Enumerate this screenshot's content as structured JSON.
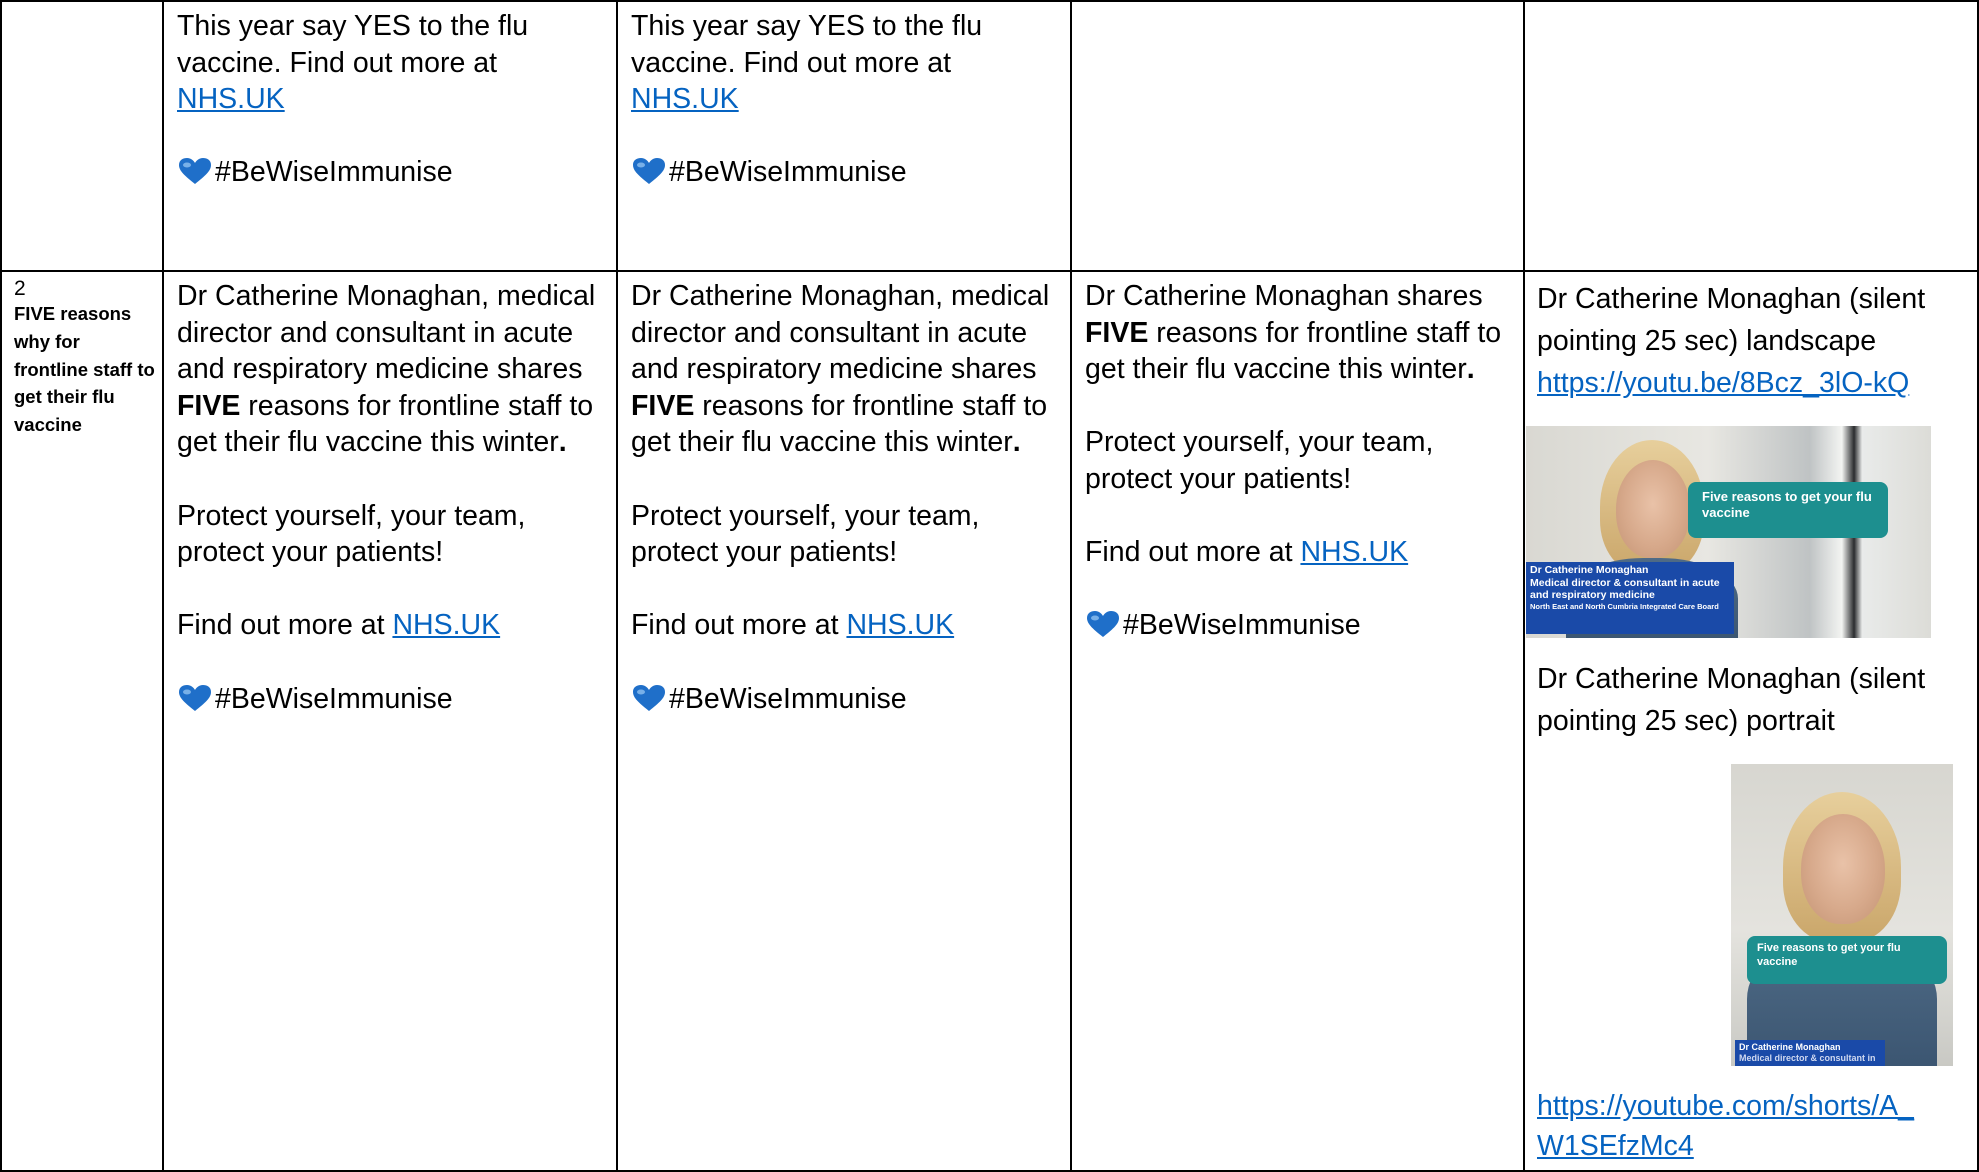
{
  "row1": {
    "col2": {
      "line1": "This year say YES to the flu vaccine. Find out more at",
      "link": "NHS.UK",
      "hashtag": "#BeWiseImmunise"
    },
    "col3": {
      "line1": "This year say YES to the flu vaccine. Find out more at",
      "link": "NHS.UK",
      "hashtag": "#BeWiseImmunise"
    }
  },
  "row2": {
    "col1": {
      "number": "2",
      "label": "FIVE reasons why for frontline staff to get their flu vaccine"
    },
    "col2": {
      "intro": "Dr Catherine Monaghan, medical director and consultant in acute and respiratory medicine shares",
      "bold": "FIVE",
      "rest": "reasons for frontline staff to get their flu vaccine this winter",
      "period": ".",
      "protect": "Protect yourself, your team, protect your patients!",
      "find_prefix": "Find out more at",
      "link": "NHS.UK",
      "hashtag": "#BeWiseImmunise"
    },
    "col3": {
      "intro": "Dr Catherine Monaghan, medical director and consultant in acute and respiratory medicine shares",
      "bold": "FIVE",
      "rest": "reasons for frontline staff to get their flu vaccine this winter",
      "period": ".",
      "protect": "Protect yourself, your team, protect your patients!",
      "find_prefix": "Find out more at",
      "link": "NHS.UK",
      "hashtag": "#BeWiseImmunise"
    },
    "col4": {
      "intro": "Dr Catherine Monaghan shares",
      "bold": "FIVE",
      "rest": "reasons for frontline staff to get their flu vaccine this winter",
      "period": ".",
      "protect": "Protect yourself, your team, protect your patients!",
      "find_prefix": "Find out more at",
      "link": "NHS.UK",
      "hashtag": "#BeWiseImmunise"
    },
    "col5": {
      "landscape_caption": "Dr Catherine Monaghan (silent pointing 25 sec) landscape",
      "landscape_link": "https://youtu.be/8Bcz_3lO-kQ",
      "landscape_thumb": {
        "speech": "Five reasons to get your flu vaccine",
        "name": "Dr Catherine Monaghan",
        "role": "Medical director & consultant in acute and respiratory medicine",
        "org": "North East and North Cumbria Integrated Care Board"
      },
      "portrait_caption": "Dr Catherine Monaghan (silent pointing 25 sec) portrait",
      "portrait_thumb": {
        "speech": "Five reasons to get your flu vaccine",
        "name": "Dr Catherine Monaghan",
        "role": "Medical director & consultant in"
      },
      "portrait_link_line1": "https://youtube.com/shorts/A_",
      "portrait_link_line2": "W1SEfzMc4"
    }
  },
  "colors": {
    "link": "#0563c1",
    "heart": "#1f6fc9",
    "speech_bubble": "#1d8f8f",
    "name_tag": "#1a4aa8"
  }
}
